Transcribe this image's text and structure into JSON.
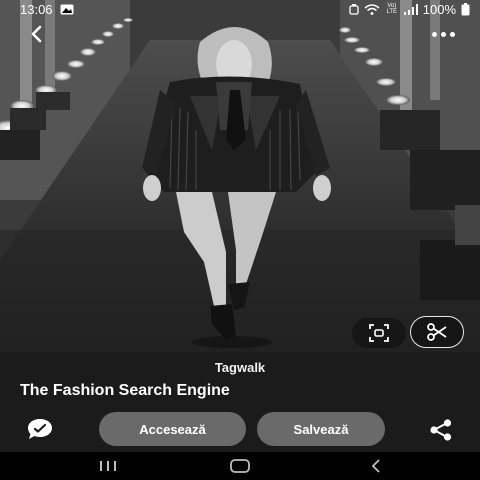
{
  "status_bar": {
    "time": "13:06",
    "signal_label": "Vo) LTE",
    "battery": "100%"
  },
  "image": {
    "subject": "runway-model-photo"
  },
  "result": {
    "source": "Tagwalk",
    "title": "The Fashion Search Engine"
  },
  "actions": {
    "access_label": "Accesează",
    "save_label": "Salvează"
  },
  "icons": {
    "back": "chevron-left-icon",
    "more": "more-vertical-icon",
    "lens": "lens-scan-icon",
    "crop": "scissors-icon",
    "comment": "comment-icon",
    "share": "share-icon"
  }
}
